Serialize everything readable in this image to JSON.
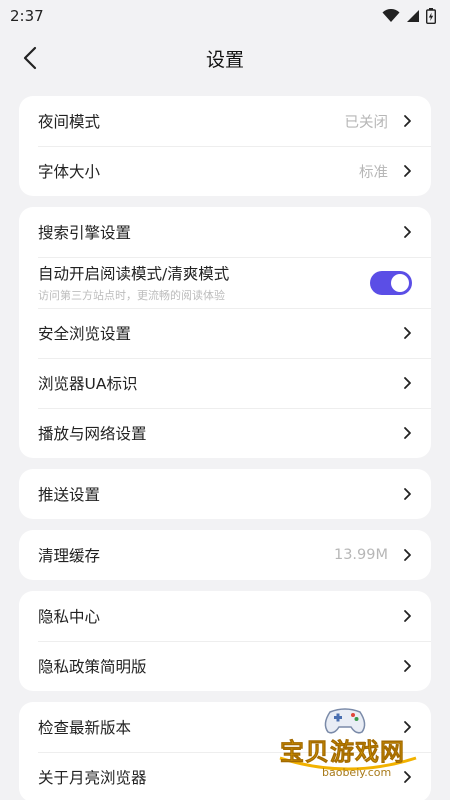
{
  "status_bar": {
    "time": "2:37",
    "icons": [
      "wifi-icon",
      "signal-icon",
      "battery-icon"
    ]
  },
  "header": {
    "title": "设置",
    "back_icon": "back-arrow-icon"
  },
  "groups": [
    {
      "rows": [
        {
          "label": "夜间模式",
          "value": "已关闭"
        },
        {
          "label": "字体大小",
          "value": "标准"
        }
      ]
    },
    {
      "rows": [
        {
          "label": "搜索引擎设置"
        },
        {
          "label": "自动开启阅读模式/清爽模式",
          "subtitle": "访问第三方站点时，更流畅的阅读体验",
          "toggle": true
        },
        {
          "label": "安全浏览设置"
        },
        {
          "label": "浏览器UA标识"
        },
        {
          "label": "播放与网络设置"
        }
      ]
    },
    {
      "rows": [
        {
          "label": "推送设置"
        }
      ]
    },
    {
      "rows": [
        {
          "label": "清理缓存",
          "value": "13.99M"
        }
      ]
    },
    {
      "rows": [
        {
          "label": "隐私中心"
        },
        {
          "label": "隐私政策简明版"
        }
      ]
    },
    {
      "rows": [
        {
          "label": "检查最新版本"
        },
        {
          "label": "关于月亮浏览器"
        }
      ]
    }
  ],
  "watermark": {
    "title": "宝贝游戏网",
    "url": "baobeiy.com"
  },
  "colors": {
    "toggle_on": "#5b4ee6",
    "background": "#f2f2f4",
    "card": "#ffffff"
  }
}
